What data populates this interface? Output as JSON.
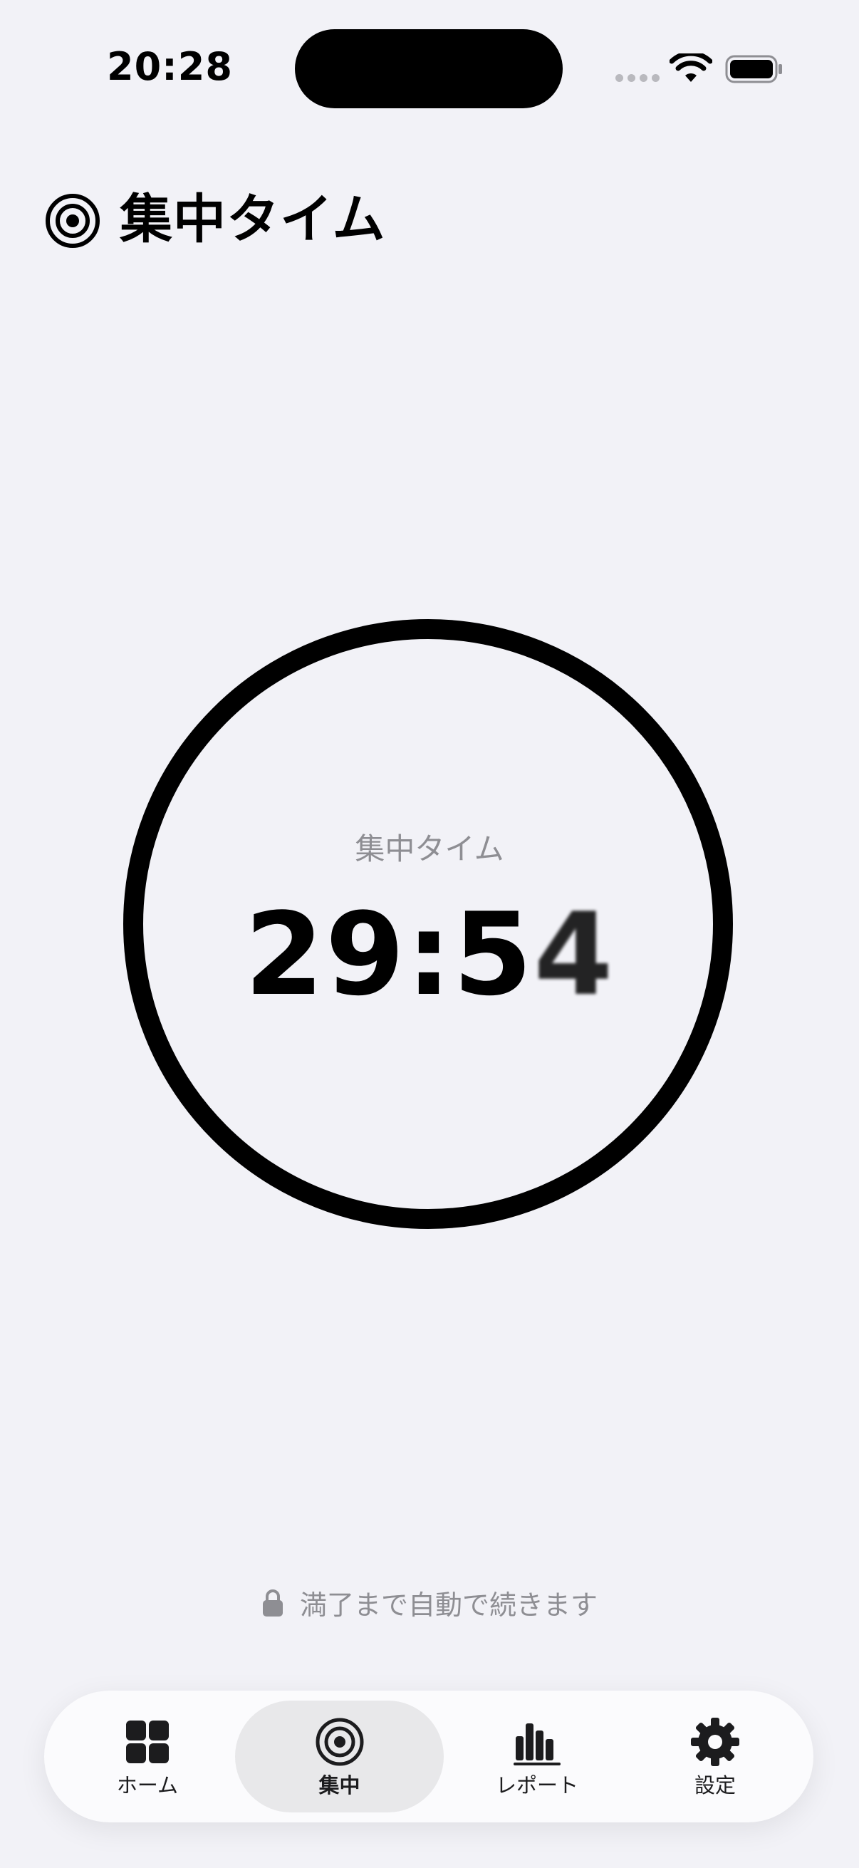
{
  "status_bar": {
    "time": "20:28"
  },
  "header": {
    "title": "集中タイム",
    "icon": "target-icon"
  },
  "timer": {
    "label": "集中タイム",
    "value_main": "29:5",
    "value_last_digit": "4"
  },
  "note": {
    "icon": "lock-icon",
    "text": "満了まで自動で続きます"
  },
  "tab_bar": {
    "active": "集中",
    "items": [
      {
        "label": "ホーム",
        "icon": "grid-icon"
      },
      {
        "label": "集中",
        "icon": "target-icon"
      },
      {
        "label": "レポート",
        "icon": "bar-chart-icon"
      },
      {
        "label": "設定",
        "icon": "gear-icon"
      }
    ]
  },
  "colors": {
    "background": "#f2f2f7",
    "tab_bar": "#fbfbfd",
    "active_tab": "#e8e8ea",
    "secondary_text": "#8e8e93",
    "primary": "#000000"
  }
}
